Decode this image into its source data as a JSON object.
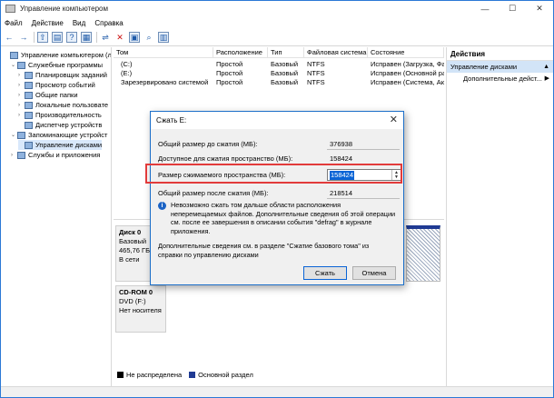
{
  "window": {
    "title": "Управление компьютером"
  },
  "menu": [
    "Файл",
    "Действие",
    "Вид",
    "Справка"
  ],
  "tree": [
    {
      "label": "Управление компьютером (л",
      "indent": 0,
      "twisty": "",
      "icon": "computer-icon"
    },
    {
      "label": "Служебные программы",
      "indent": 1,
      "twisty": "⌄",
      "icon": "tools-icon"
    },
    {
      "label": "Планировщик заданий",
      "indent": 2,
      "twisty": "›",
      "icon": "scheduler-icon"
    },
    {
      "label": "Просмотр событий",
      "indent": 2,
      "twisty": "›",
      "icon": "event-viewer-icon"
    },
    {
      "label": "Общие папки",
      "indent": 2,
      "twisty": "›",
      "icon": "shared-folder-icon"
    },
    {
      "label": "Локальные пользовате",
      "indent": 2,
      "twisty": "›",
      "icon": "users-icon"
    },
    {
      "label": "Производительность",
      "indent": 2,
      "twisty": "›",
      "icon": "performance-icon"
    },
    {
      "label": "Диспетчер устройств",
      "indent": 2,
      "twisty": "",
      "icon": "device-manager-icon"
    },
    {
      "label": "Запоминающие устройст",
      "indent": 1,
      "twisty": "⌄",
      "icon": "storage-icon"
    },
    {
      "label": "Управление дисками",
      "indent": 2,
      "twisty": "",
      "icon": "disk-management-icon",
      "selected": true
    },
    {
      "label": "Службы и приложения",
      "indent": 1,
      "twisty": "›",
      "icon": "services-icon"
    }
  ],
  "list": {
    "columns": [
      "Том",
      "Расположение",
      "Тип",
      "Файловая система",
      "Состояние"
    ],
    "rows": [
      [
        "(C:)",
        "Простой",
        "Базовый",
        "NTFS",
        "Исправен (Загрузка, Файл"
      ],
      [
        "(E:)",
        "Простой",
        "Базовый",
        "NTFS",
        "Исправен (Основной разд"
      ],
      [
        "Зарезервировано системой",
        "Простой",
        "Базовый",
        "NTFS",
        "Исправен (Система, Акти"
      ]
    ]
  },
  "actions": {
    "header": "Действия",
    "section": "Управление дисками",
    "section_arrow": "▲",
    "items": [
      "Дополнительные дейст..."
    ],
    "item_arrow": "▶"
  },
  "disks": [
    {
      "name": "Диск 0",
      "lines": [
        "Базовый",
        "465,76 ГБ",
        "В сети"
      ]
    },
    {
      "name": "CD-ROM 0",
      "lines": [
        "DVD (F:)",
        "",
        "Нет носителя"
      ]
    }
  ],
  "legend": [
    {
      "label": "Не распределена",
      "color": "#000000"
    },
    {
      "label": "Основной раздел",
      "color": "#1f3a93"
    }
  ],
  "dialog": {
    "title": "Сжать E:",
    "close": "✕",
    "total_before_label": "Общий размер до сжатия (МБ):",
    "total_before_value": "376938",
    "available_label": "Доступное для сжатия пространство (МБ):",
    "available_value": "158424",
    "shrink_label": "Размер сжимаемого пространства (МБ):",
    "shrink_value": "158424",
    "total_after_label": "Общий размер после сжатия (МБ):",
    "total_after_value": "218514",
    "info_text": "Невозможно сжать том дальше области расположения неперемещаемых файлов. Дополнительные сведения об этой операции см. после ее завершения в описании события \"defrag\" в журнале приложения.",
    "more_text": "Дополнительные сведения см. в разделе \"Сжатие базового тома\" из справки по управлению дисками",
    "shrink_button": "Сжать",
    "cancel_button": "Отмена"
  }
}
